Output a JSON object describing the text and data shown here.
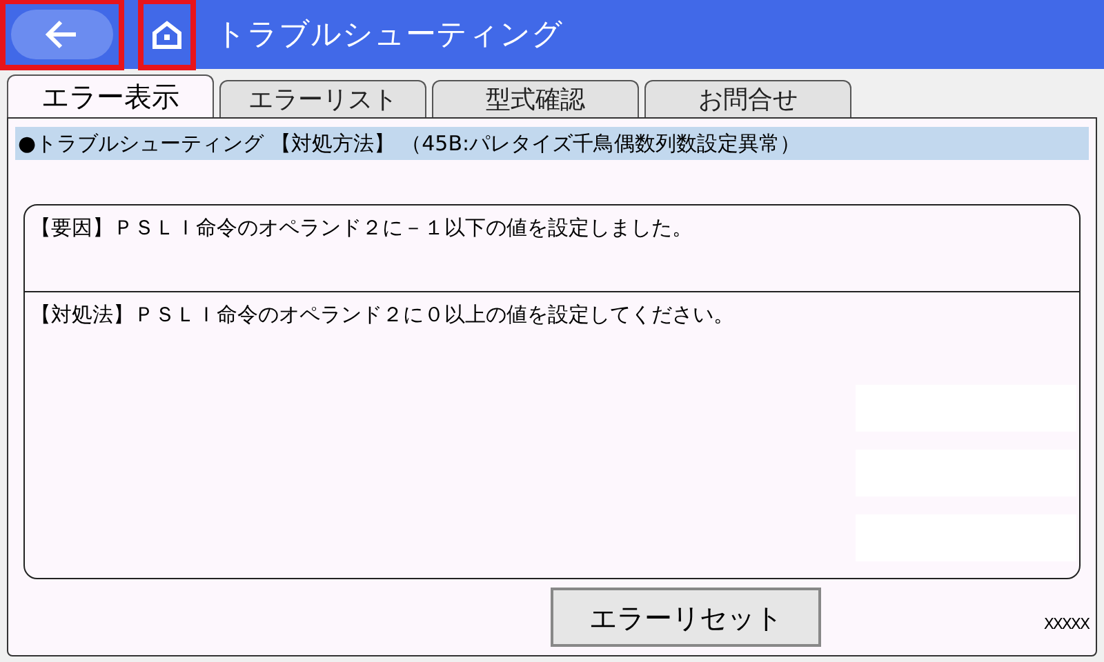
{
  "header": {
    "back_button": {
      "highlighted": true
    },
    "home_button": {
      "highlighted": true
    },
    "title": "トラブルシューティング"
  },
  "tabs": [
    {
      "label": "エラー表示",
      "selected": true
    },
    {
      "label": "エラーリスト",
      "selected": false
    },
    {
      "label": "型式確認",
      "selected": false
    },
    {
      "label": "お問合せ",
      "selected": false
    }
  ],
  "heading": "●トラブルシューティング 【対処方法】 （45B:パレタイズ千鳥偶数列数設定異常）",
  "cause": "【要因】ＰＳＬＩ命令のオペランド２に－１以下の値を設定しました。",
  "remedy": "【対処法】ＰＳＬＩ命令のオペランド２に０以上の値を設定してください。",
  "reset_button": "エラーリセット",
  "code": "XXXXX"
}
